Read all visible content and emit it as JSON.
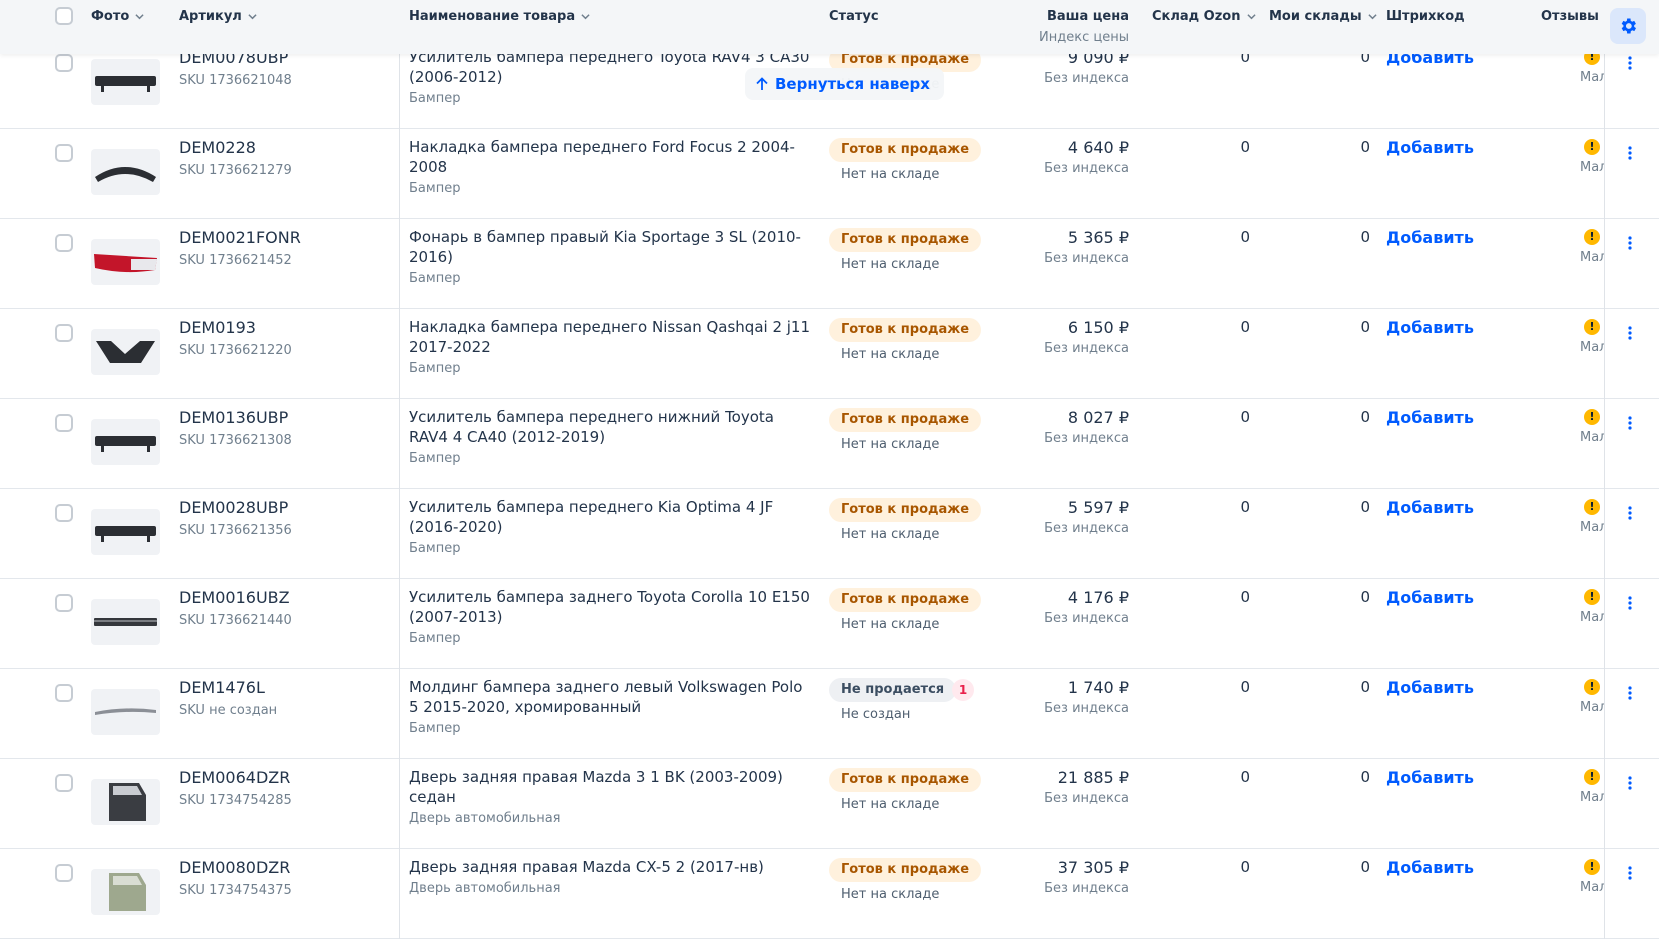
{
  "header": {
    "photo": "Фото",
    "article": "Артикул",
    "name": "Наименование товара",
    "status": "Статус",
    "price": "Ваша цена",
    "price_sub": "Индекс цены",
    "ozon": "Склад Ozon",
    "mine": "Мои склады",
    "barcode": "Штрихкод",
    "reviews": "Отзывы"
  },
  "back_to_top": "Вернуться наверх",
  "colors": {
    "accent": "#005bff",
    "status_ok_bg": "#fff1dd",
    "status_ok_fg": "#a85600",
    "warning": "#ffb800"
  },
  "rows": [
    {
      "article": "DEM0078UBP",
      "sku": "SKU 1736621048",
      "name": "Усилитель бампера переднего Toyota RAV4 3 CA30 (2006-2012)",
      "category": "Бампер",
      "status": "Готов к продаже",
      "status_kind": "ok",
      "stock": "Нет на складе",
      "price": "9 090 ₽",
      "price_sub": "Без индекса",
      "ozon": "0",
      "mine": "0",
      "barcode": "Добавить",
      "warn": "!",
      "reviews": "Мало",
      "thumb": "bar"
    },
    {
      "article": "DEM0228",
      "sku": "SKU 1736621279",
      "name": "Накладка бампера переднего Ford Focus 2 2004-2008",
      "category": "Бампер",
      "status": "Готов к продаже",
      "status_kind": "ok",
      "stock": "Нет на складе",
      "price": "4 640 ₽",
      "price_sub": "Без индекса",
      "ozon": "0",
      "mine": "0",
      "barcode": "Добавить",
      "warn": "!",
      "reviews": "Мало",
      "thumb": "arch"
    },
    {
      "article": "DEM0021FONR",
      "sku": "SKU 1736621452",
      "name": "Фонарь в бампер правый Kia Sportage 3 SL (2010-2016)",
      "category": "Бампер",
      "status": "Готов к продаже",
      "status_kind": "ok",
      "stock": "Нет на складе",
      "price": "5 365 ₽",
      "price_sub": "Без индекса",
      "ozon": "0",
      "mine": "0",
      "barcode": "Добавить",
      "warn": "!",
      "reviews": "Мало",
      "thumb": "lamp"
    },
    {
      "article": "DEM0193",
      "sku": "SKU 1736621220",
      "name": "Накладка бампера переднего Nissan Qashqai 2 j11 2017-2022",
      "category": "Бампер",
      "status": "Готов к продаже",
      "status_kind": "ok",
      "stock": "Нет на складе",
      "price": "6 150 ₽",
      "price_sub": "Без индекса",
      "ozon": "0",
      "mine": "0",
      "barcode": "Добавить",
      "warn": "!",
      "reviews": "Мало",
      "thumb": "vshape"
    },
    {
      "article": "DEM0136UBP",
      "sku": "SKU 1736621308",
      "name": "Усилитель бампера переднего нижний Toyota RAV4 4 CA40 (2012-2019)",
      "category": "Бампер",
      "status": "Готов к продаже",
      "status_kind": "ok",
      "stock": "Нет на складе",
      "price": "8 027 ₽",
      "price_sub": "Без индекса",
      "ozon": "0",
      "mine": "0",
      "barcode": "Добавить",
      "warn": "!",
      "reviews": "Мало",
      "thumb": "bar"
    },
    {
      "article": "DEM0028UBP",
      "sku": "SKU 1736621356",
      "name": "Усилитель бампера переднего Kia Optima 4 JF (2016-2020)",
      "category": "Бампер",
      "status": "Готов к продаже",
      "status_kind": "ok",
      "stock": "Нет на складе",
      "price": "5 597 ₽",
      "price_sub": "Без индекса",
      "ozon": "0",
      "mine": "0",
      "barcode": "Добавить",
      "warn": "!",
      "reviews": "Мало",
      "thumb": "bar"
    },
    {
      "article": "DEM0016UBZ",
      "sku": "SKU 1736621440",
      "name": "Усилитель бампера заднего Toyota Corolla 10 E150 (2007-2013)",
      "category": "Бампер",
      "status": "Готов к продаже",
      "status_kind": "ok",
      "stock": "Нет на складе",
      "price": "4 176 ₽",
      "price_sub": "Без индекса",
      "ozon": "0",
      "mine": "0",
      "barcode": "Добавить",
      "warn": "!",
      "reviews": "Мало",
      "thumb": "flat"
    },
    {
      "article": "DEM1476L",
      "sku": "SKU не создан",
      "name": "Молдинг бампера заднего левый Volkswagen Polo 5 2015-2020, хромированный",
      "category": "Бампер",
      "status": "Не продается",
      "status_kind": "no",
      "count": "1",
      "stock": "Не создан",
      "price": "1 740 ₽",
      "price_sub": "Без индекса",
      "ozon": "0",
      "mine": "0",
      "barcode": "Добавить",
      "warn": "!",
      "reviews": "Мало",
      "thumb": "molding"
    },
    {
      "article": "DEM0064DZR",
      "sku": "SKU 1734754285",
      "name": "Дверь задняя правая Mazda 3 1 BK (2003-2009) седан",
      "category": "Дверь автомобильная",
      "status": "Готов к продаже",
      "status_kind": "ok",
      "stock": "Нет на складе",
      "price": "21 885 ₽",
      "price_sub": "Без индекса",
      "ozon": "0",
      "mine": "0",
      "barcode": "Добавить",
      "warn": "!",
      "reviews": "Мало",
      "thumb": "door"
    },
    {
      "article": "DEM0080DZR",
      "sku": "SKU 1734754375",
      "name": "Дверь задняя правая Mazda CX-5 2 (2017-нв)",
      "category": "Дверь автомобильная",
      "status": "Готов к продаже",
      "status_kind": "ok",
      "stock": "Нет на складе",
      "price": "37 305 ₽",
      "price_sub": "Без индекса",
      "ozon": "0",
      "mine": "0",
      "barcode": "Добавить",
      "warn": "!",
      "reviews": "Мало",
      "thumb": "door-green"
    }
  ]
}
